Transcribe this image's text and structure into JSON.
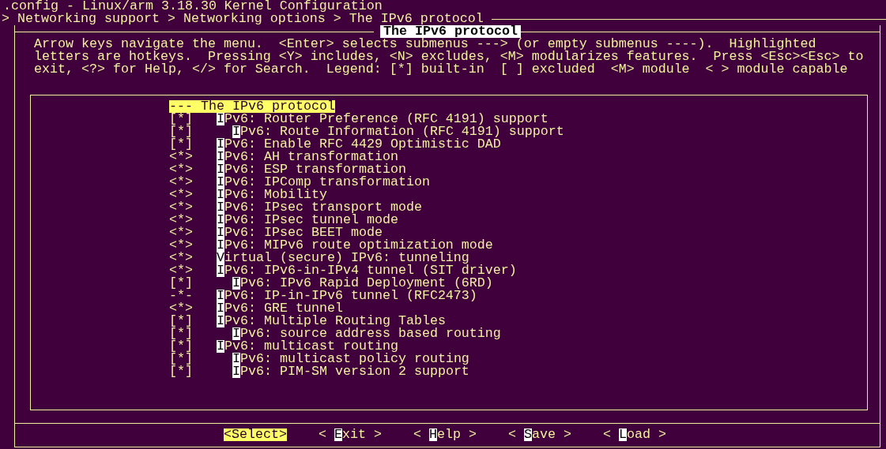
{
  "window": {
    "title": ".config - Linux/arm 3.18.30 Kernel Configuration"
  },
  "breadcrumb": "> Networking support > Networking options > The IPv6 protocol",
  "dialog": {
    "title": "The IPv6 protocol",
    "help": [
      "Arrow keys navigate the menu.  <Enter> selects submenus ---> (or empty submenus ----).  Highlighted",
      "letters are hotkeys.  Pressing <Y> includes, <N> excludes, <M> modularizes features.  Press <Esc><Esc> to",
      "exit, <?> for Help, </> for Search.  Legend: [*] built-in  [ ] excluded  <M> module  < > module capable"
    ],
    "menu": [
      {
        "kind": "header",
        "text": "--- The IPv6 protocol",
        "selected": true
      },
      {
        "kind": "option",
        "status": "[*]",
        "hotkey": "I",
        "rest": "Pv6: Router Preference (RFC 4191) support",
        "selected": false,
        "children": [
          {
            "kind": "option",
            "status": "[*]",
            "hotkey": "I",
            "rest": "Pv6: Route Information (RFC 4191) support",
            "selected": false
          }
        ]
      },
      {
        "kind": "option",
        "status": "[*]",
        "hotkey": "I",
        "rest": "Pv6: Enable RFC 4429 Optimistic DAD",
        "selected": false
      },
      {
        "kind": "option",
        "status": "<*>",
        "hotkey": "I",
        "rest": "Pv6: AH transformation",
        "selected": false
      },
      {
        "kind": "option",
        "status": "<*>",
        "hotkey": "I",
        "rest": "Pv6: ESP transformation",
        "selected": false
      },
      {
        "kind": "option",
        "status": "<*>",
        "hotkey": "I",
        "rest": "Pv6: IPComp transformation",
        "selected": false
      },
      {
        "kind": "option",
        "status": "<*>",
        "hotkey": "I",
        "rest": "Pv6: Mobility",
        "selected": false
      },
      {
        "kind": "option",
        "status": "<*>",
        "hotkey": "I",
        "rest": "Pv6: IPsec transport mode",
        "selected": false
      },
      {
        "kind": "option",
        "status": "<*>",
        "hotkey": "I",
        "rest": "Pv6: IPsec tunnel mode",
        "selected": false
      },
      {
        "kind": "option",
        "status": "<*>",
        "hotkey": "I",
        "rest": "Pv6: IPsec BEET mode",
        "selected": false
      },
      {
        "kind": "option",
        "status": "<*>",
        "hotkey": "I",
        "rest": "Pv6: MIPv6 route optimization mode",
        "selected": false
      },
      {
        "kind": "option",
        "status": "<*>",
        "hotkey": "V",
        "rest": "irtual (secure) IPv6: tunneling",
        "selected": false
      },
      {
        "kind": "option",
        "status": "<*>",
        "hotkey": "I",
        "rest": "Pv6: IPv6-in-IPv4 tunnel (SIT driver)",
        "selected": false,
        "children": [
          {
            "kind": "option",
            "status": "[*]",
            "hotkey": "I",
            "rest": "Pv6: IPv6 Rapid Deployment (6RD)",
            "selected": false
          }
        ]
      },
      {
        "kind": "option",
        "status": "-*-",
        "hotkey": "I",
        "rest": "Pv6: IP-in-IPv6 tunnel (RFC2473)",
        "selected": false
      },
      {
        "kind": "option",
        "status": "<*>",
        "hotkey": "I",
        "rest": "Pv6: GRE tunnel",
        "selected": false
      },
      {
        "kind": "option",
        "status": "[*]",
        "hotkey": "I",
        "rest": "Pv6: Multiple Routing Tables",
        "selected": false,
        "children": [
          {
            "kind": "option",
            "status": "[*]",
            "hotkey": "I",
            "rest": "Pv6: source address based routing",
            "selected": false
          }
        ]
      },
      {
        "kind": "option",
        "status": "[*]",
        "hotkey": "I",
        "rest": "Pv6: multicast routing",
        "selected": false,
        "children": [
          {
            "kind": "option",
            "status": "[*]",
            "hotkey": "I",
            "rest": "Pv6: multicast policy routing",
            "selected": false
          },
          {
            "kind": "option",
            "status": "[*]",
            "hotkey": "I",
            "rest": "Pv6: PIM-SM version 2 support",
            "selected": false
          }
        ]
      }
    ],
    "buttons": [
      {
        "prefix": "<Select>",
        "selected": true
      },
      {
        "prefix": "< ",
        "hotkey": "E",
        "rest": "xit >",
        "selected": false
      },
      {
        "prefix": "< ",
        "hotkey": "H",
        "rest": "elp >",
        "selected": false
      },
      {
        "prefix": "< ",
        "hotkey": "S",
        "rest": "ave >",
        "selected": false
      },
      {
        "prefix": "< ",
        "hotkey": "L",
        "rest": "oad >",
        "selected": false
      }
    ]
  }
}
